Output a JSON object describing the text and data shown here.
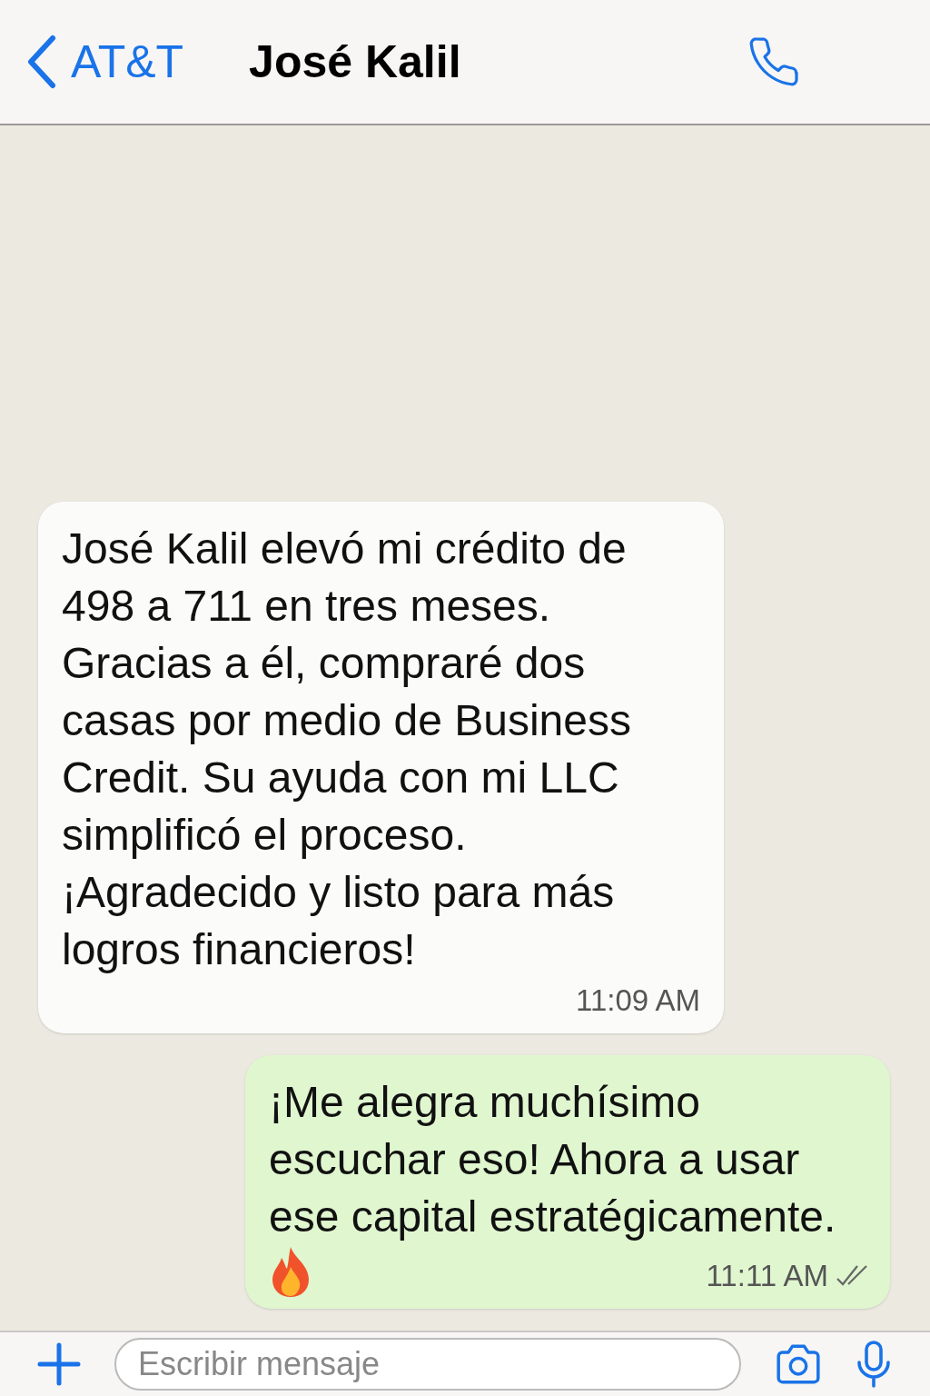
{
  "header": {
    "back_label": "AT&T",
    "contact_name": "José Kalil"
  },
  "messages": [
    {
      "kind": "incoming",
      "text": "José Kalil elevó mi crédito de 498 a 711 en tres meses. Gracias a él, compraré dos casas por medio de Business Credit. Su ayuda con mi LLC simplificó el proceso. ¡Agradecido y listo para más logros financieros!",
      "time": "11:09 AM"
    },
    {
      "kind": "outgoing",
      "text": "¡Me alegra muchísimo escuchar eso! Ahora a usar ese capital estratégicamente.",
      "time": "11:11 AM",
      "read": false
    }
  ],
  "composer": {
    "placeholder": "Escribir mensaje"
  }
}
